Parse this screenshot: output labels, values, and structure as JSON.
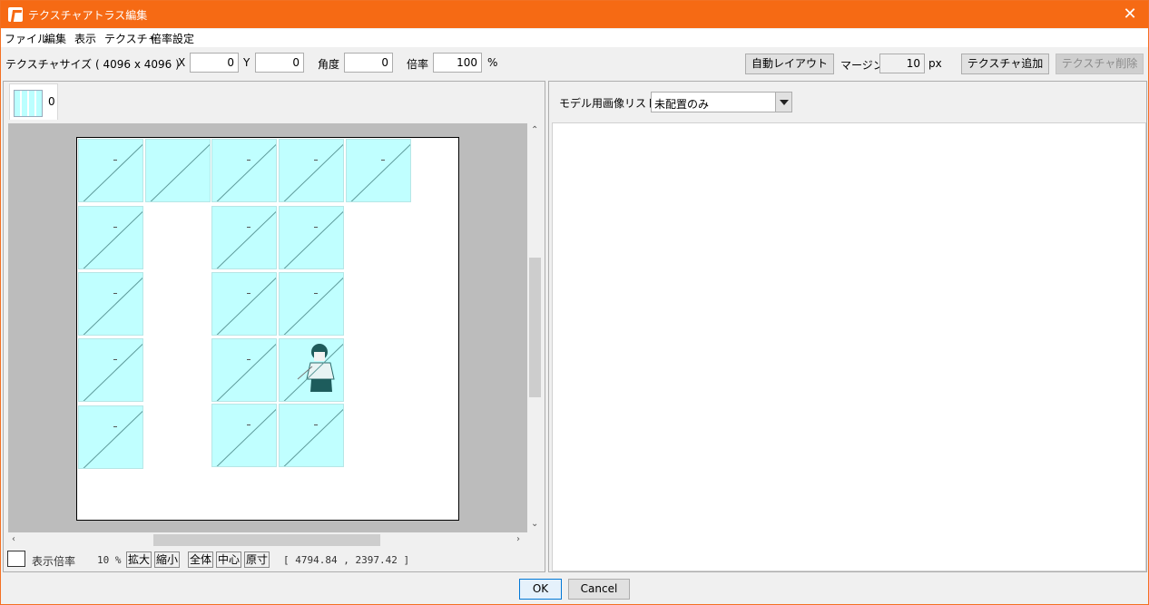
{
  "window": {
    "title": "テクスチャアトラス編集",
    "close": "✕"
  },
  "menu": [
    "ファイル",
    "編集",
    "表示",
    "テクスチャ",
    "倍率設定"
  ],
  "toolbar": {
    "texture_size": "テクスチャサイズ ( 4096 x 4096 )",
    "x_label": "X",
    "x_value": "0",
    "y_label": "Y",
    "y_value": "0",
    "angle_label": "角度",
    "angle_value": "0",
    "scale_label": "倍率",
    "scale_value": "100",
    "scale_unit": "%",
    "auto_layout": "自動レイアウト",
    "margin_label": "マージン",
    "margin_value": "10",
    "margin_unit": "px",
    "add_texture": "テクスチャ追加",
    "remove_texture": "テクスチャ削除"
  },
  "left": {
    "tab_label": "0",
    "status": {
      "zoom_label": "表示倍率",
      "zoom_value": "10 %",
      "zoom_in": "拡大",
      "zoom_out": "縮小",
      "fit_all": "全体",
      "center": "中心",
      "actual": "原寸",
      "coords": "[ 4794.84 , 2397.42 ]"
    }
  },
  "right": {
    "list_label": "モデル用画像リスト",
    "filter_value": "未配置のみ"
  },
  "buttons": {
    "ok": "OK",
    "cancel": "Cancel"
  },
  "colors": {
    "title_bar": "#f66a14",
    "tile": "#c0ffff",
    "canvas_bg": "#bcbcbc"
  }
}
